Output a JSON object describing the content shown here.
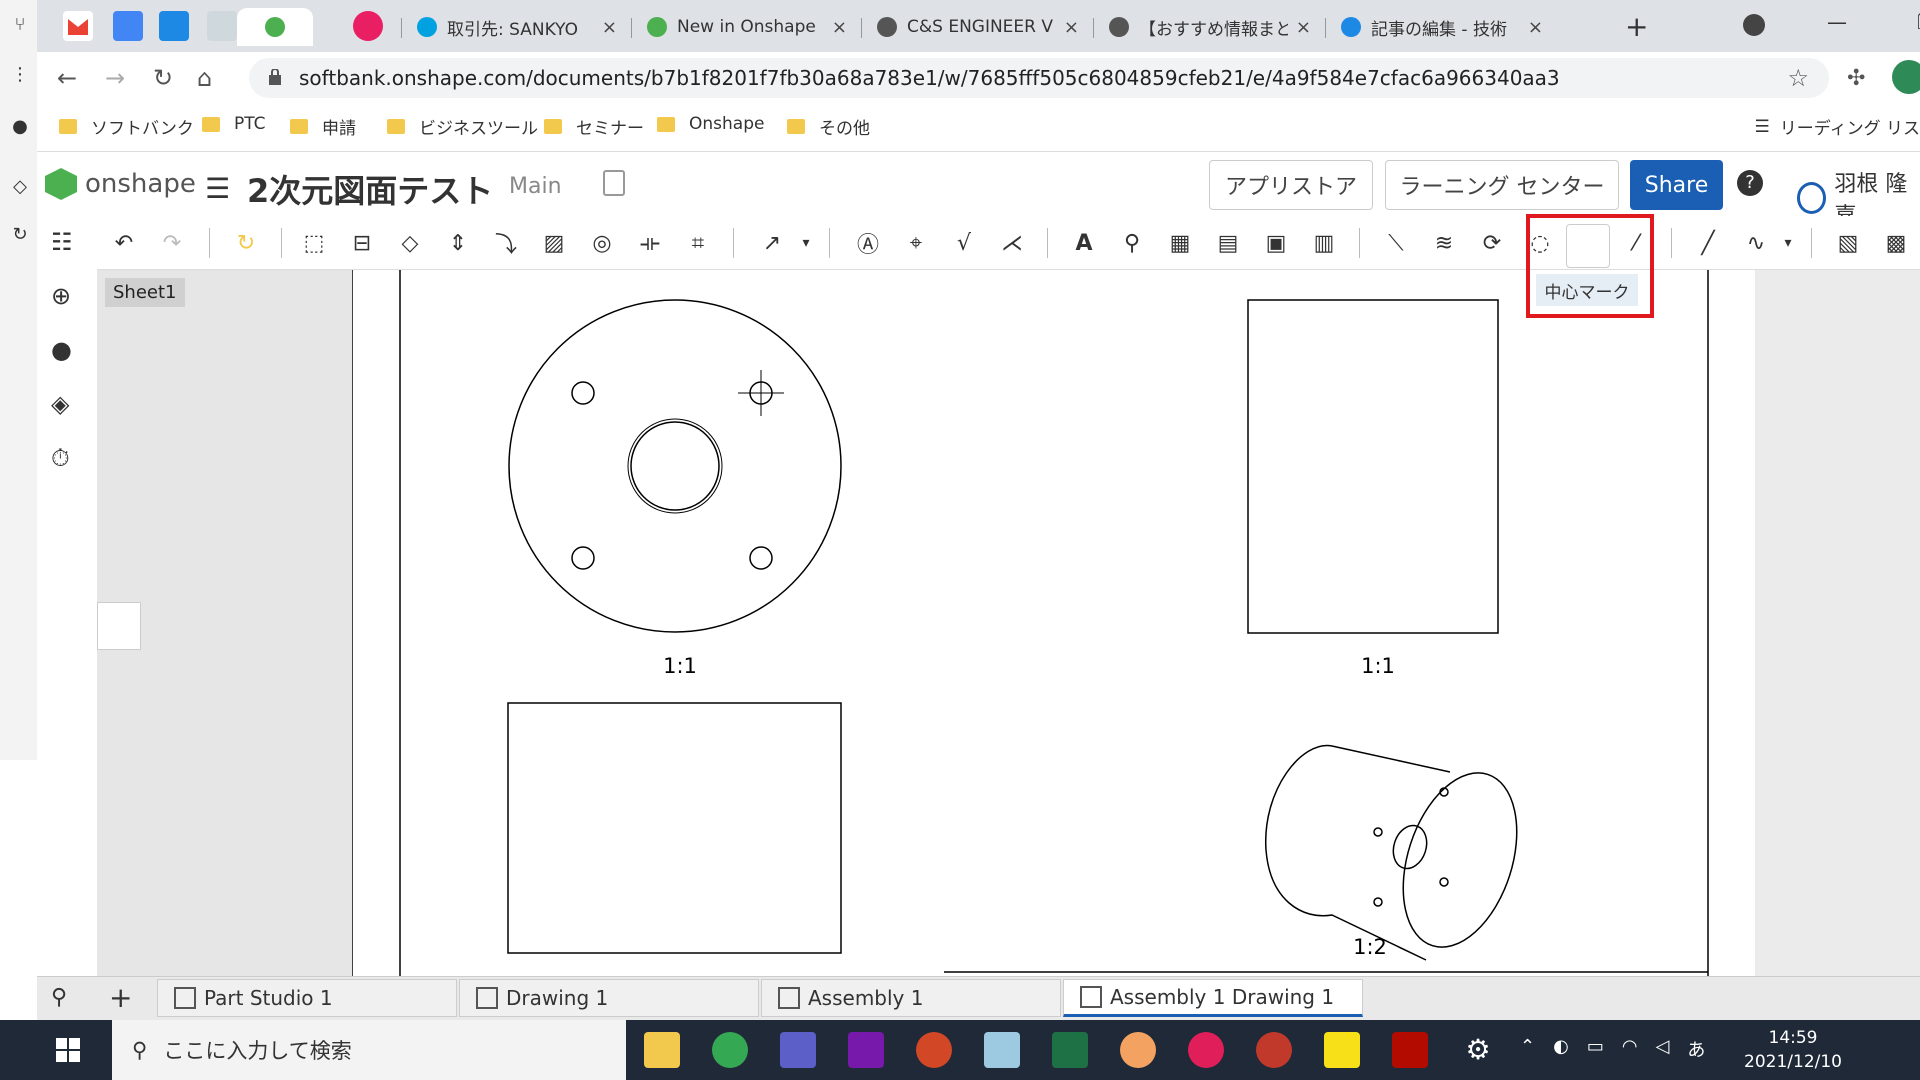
{
  "browser": {
    "tabs": [
      {
        "label": "取引先: SANKYO",
        "color": "#00a1e0"
      },
      {
        "label": "New in Onshape",
        "color": "#4caf50"
      },
      {
        "label": "C&S ENGINEER V",
        "color": "#555555"
      },
      {
        "label": "【おすすめ情報まと",
        "color": "#555555"
      },
      {
        "label": "記事の編集 - 技術",
        "color": "#1e88e5"
      }
    ],
    "tab_close": "×",
    "new_tab": "+",
    "url": "softbank.onshape.com/documents/b7b1f8201f7fb30a68a783e1/w/7685fff505c6804859cfeb21/e/4a9f584e7cfac6a966340aa3",
    "bookmarks": [
      "ソフトバンク",
      "PTC",
      "申請",
      "ビジネスツール",
      "セミナー",
      "Onshape",
      "その他"
    ],
    "reading_list": "リーディング リス"
  },
  "onshape": {
    "logo": "onshape",
    "doc_title": "2次元図面テスト",
    "branch": "Main",
    "app_store": "アプリストア",
    "learning_center": "ラーニング センター",
    "share": "Share",
    "help": "?",
    "user": "羽根 隆嘉",
    "sheet": "Sheet1",
    "tooltip": "中心マーク",
    "tabs": [
      {
        "label": "Part Studio 1",
        "active": false
      },
      {
        "label": "Drawing 1",
        "active": false
      },
      {
        "label": "Assembly 1",
        "active": false
      },
      {
        "label": "Assembly 1 Drawing 1",
        "active": true
      }
    ],
    "add_tab": "+",
    "views": [
      {
        "scale": "1:1"
      },
      {
        "scale": "1:1"
      },
      {
        "scale": "1:2"
      }
    ]
  },
  "taskbar": {
    "search_placeholder": "ここに入力して検索",
    "time": "14:59",
    "date": "2021/12/10",
    "ime": "あ"
  },
  "colors": {
    "accent": "#1a5fb4",
    "highlight": "#e0191e"
  }
}
